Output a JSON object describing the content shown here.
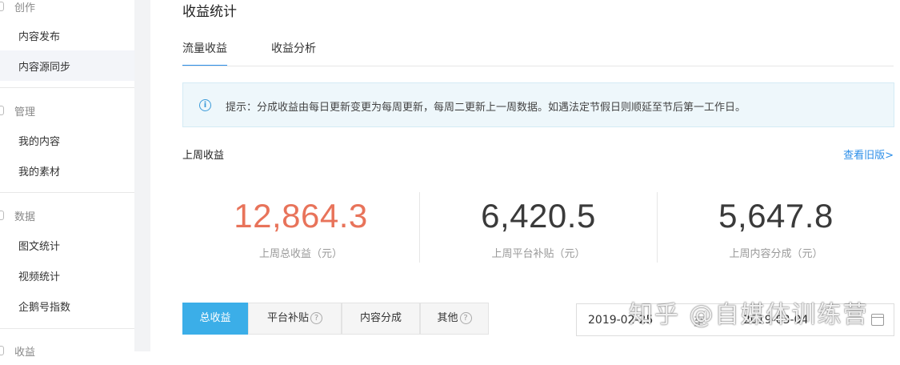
{
  "sidebar": {
    "sections": [
      {
        "label": "创作",
        "items": [
          {
            "label": "内容发布"
          },
          {
            "label": "内容源同步"
          }
        ]
      },
      {
        "label": "管理",
        "items": [
          {
            "label": "我的内容"
          },
          {
            "label": "我的素材"
          }
        ]
      },
      {
        "label": "数据",
        "items": [
          {
            "label": "图文统计"
          },
          {
            "label": "视频统计"
          },
          {
            "label": "企鹅号指数"
          }
        ]
      },
      {
        "label": "收益"
      }
    ]
  },
  "page": {
    "title": "收益统计",
    "tabs": [
      {
        "label": "流量收益"
      },
      {
        "label": "收益分析"
      }
    ],
    "tip": "提示：分成收益由每日更新变更为每周更新，每周二更新上一周数据。如遇法定节假日则顺延至节后第一工作日。",
    "section_title": "上周收益",
    "old_version_link": "查看旧版>",
    "stats": [
      {
        "value": "12,864.3",
        "label": "上周总收益（元）"
      },
      {
        "value": "6,420.5",
        "label": "上周平台补贴（元）"
      },
      {
        "value": "5,647.8",
        "label": "上周内容分成（元）"
      }
    ],
    "filter_tabs": [
      {
        "label": "总收益"
      },
      {
        "label": "平台补贴"
      },
      {
        "label": "内容分成"
      },
      {
        "label": "其他"
      }
    ],
    "date_range": {
      "start": "2019-02-25",
      "separator": "至",
      "end": "2019-03-04"
    },
    "watermark": "知乎 @自媒体训练营"
  },
  "colors": {
    "accent": "#2b8ee8",
    "active_tab_bg": "#3baee8",
    "highlight_value": "#e8735a",
    "tip_bg": "#eef7fb"
  }
}
